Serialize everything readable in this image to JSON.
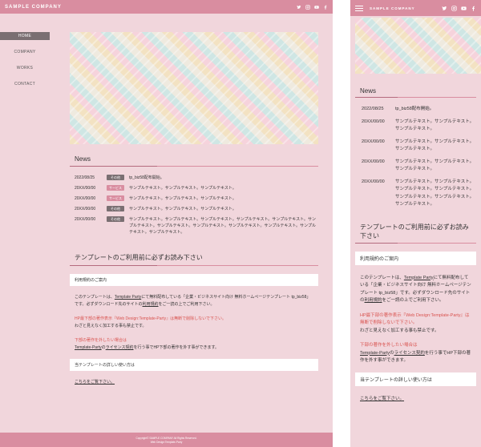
{
  "brand": {
    "logo": "SAMPLE COMPANY",
    "accent": "#d98da0",
    "bg": "#f1d6dc"
  },
  "social_icons": [
    "twitter-icon",
    "instagram-icon",
    "youtube-icon",
    "facebook-icon"
  ],
  "nav": [
    "HOME",
    "COMPANY",
    "WORKS",
    "CONTACT"
  ],
  "news": {
    "title": "News",
    "items": [
      {
        "date": "2022/08/25",
        "cat": "その他",
        "text": "tp_biz58配布開始。"
      },
      {
        "date": "20XX/00/00",
        "cat": "サービス",
        "text": "サンプルテキスト。サンプルテキスト。サンプルテキスト。"
      },
      {
        "date": "20XX/00/00",
        "cat": "サービス",
        "text": "サンプルテキスト。サンプルテキスト。サンプルテキスト。"
      },
      {
        "date": "20XX/00/00",
        "cat": "その他",
        "text": "サンプルテキスト。サンプルテキスト。サンプルテキスト。"
      },
      {
        "date": "20XX/00/00",
        "cat": "その他",
        "text": "サンプルテキスト。サンプルテキスト。サンプルテキスト。サンプルテキスト。サンプルテキスト。サンプルテキスト。サンプルテキスト。サンプルテキスト。サンプルテキスト。サンプルテキスト。サンプルテキスト。サンプルテキスト。"
      }
    ]
  },
  "mob_news": [
    {
      "date": "2022/08/25",
      "text": "tp_biz58配布開始。"
    },
    {
      "date": "20XX/00/00",
      "text": "サンプルテキスト。サンプルテキスト。サンプルテキスト。"
    },
    {
      "date": "20XX/00/00",
      "text": "サンプルテキスト。サンプルテキスト。サンプルテキスト。"
    },
    {
      "date": "20XX/00/00",
      "text": "サンプルテキスト。サンプルテキスト。サンプルテキスト。"
    },
    {
      "date": "20XX/00/00",
      "text": "サンプルテキスト。サンプルテキスト。サンプルテキスト。サンプルテキスト。サンプルテキスト。サンプルテキスト。サンプルテキスト。"
    }
  ],
  "notice": {
    "title": "テンプレートのご利用前に必ずお読み下さい",
    "box1": "利用規約のご案内",
    "p1a": "このテンプレートは、",
    "p1link1": "Template Party",
    "p1b": "にて無料配布している「企業・ビジネスサイト向け 無料ホームページテンプレート tp_biz58」です。必ずダウンロード先のサイトの",
    "p1link2": "利用規約",
    "p1c": "をご一読の上でご利用下さい。",
    "red1": "HP最下部の著作表示『Web Design:Template-Party』は無断で削除しないで下さい。",
    "p2": "わざと見えなく加工する事も禁止です。",
    "red2": "下部の著作を外したい場合は",
    "p3link1": "Template-Party",
    "p3a": "の",
    "p3link2": "ライセンス契約",
    "p3b": "を行う事でHP下部の著作を外す事ができます。",
    "box2": "当テンプレートの詳しい使い方は",
    "link": "こちらをご覧下さい。"
  },
  "footer": {
    "copy": "Copyright© SAMPLE COMPANY All Rights Reserved.",
    "design": "Web Design:Template-Party"
  }
}
